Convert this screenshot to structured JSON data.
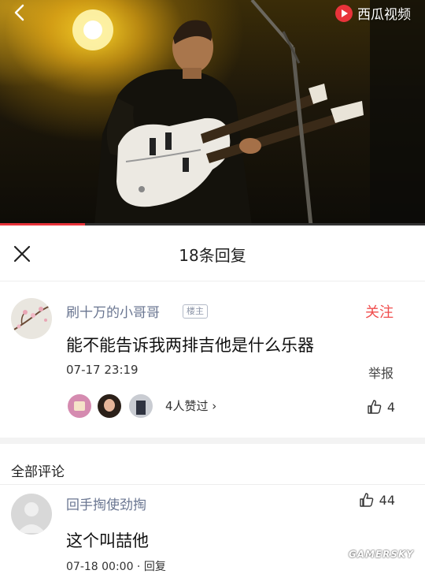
{
  "video": {
    "watermark_text": "西瓜视频",
    "progress_fraction": 0.2
  },
  "header": {
    "title": "18条回复"
  },
  "main_comment": {
    "username": "刷十万的小哥哥",
    "badge": "楼主",
    "follow_label": "关注",
    "text": "能不能告诉我两排吉他是什么乐器",
    "time": "07-17 23:19",
    "report_label": "举报",
    "liked_by_text": "4人赞过 ›",
    "like_count": "4"
  },
  "section": {
    "title": "全部评论"
  },
  "reply": {
    "username": "回手掏使劲掏",
    "text": "这个叫喆他",
    "like_count": "44",
    "time_partial": "07-18 00:00 · 回复"
  },
  "site_watermark": "GAMERSKY",
  "colors": {
    "accent_red": "#f04d4d",
    "username_blue": "#6a7691",
    "progress_red": "#e8333a"
  }
}
